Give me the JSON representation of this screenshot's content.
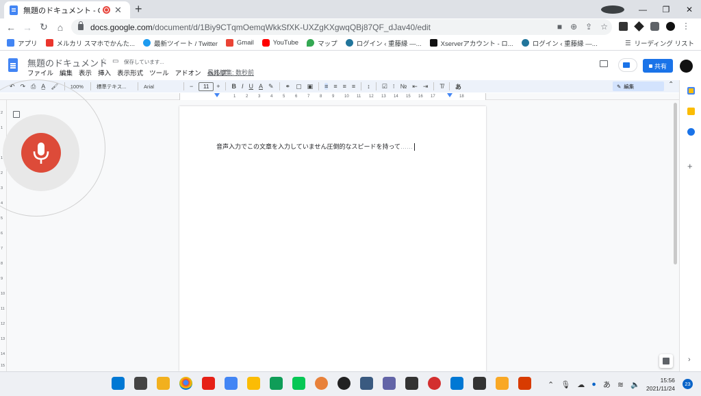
{
  "browser": {
    "tab_title": "無題のドキュメント - Google ド",
    "tab_close": "✕",
    "new_tab": "+",
    "url_host": "docs.google.com",
    "url_path": "/document/d/1Biy9CTqmOemqWkkSfXK-UXZgKXgwqQBj87QF_dJav40/edit",
    "window_controls": [
      "—",
      "❐",
      "✕"
    ]
  },
  "bookmarks": {
    "items": [
      {
        "label": "アプリ",
        "color": "#4285f4"
      },
      {
        "label": "メルカリ スマホでかんた...",
        "color": "#ea352d"
      },
      {
        "label": "最新ツイート / Twitter",
        "color": "#1d9bf0"
      },
      {
        "label": "Gmail",
        "color": "#ea4335"
      },
      {
        "label": "YouTube",
        "color": "#ff0000"
      },
      {
        "label": "マップ",
        "color": "#34a853"
      },
      {
        "label": "ログイン ‹ 重藤縁 —...",
        "color": "#21759b"
      },
      {
        "label": "Xserverアカウント - ロ...",
        "color": "#111111"
      },
      {
        "label": "ログイン ‹ 重藤縁 —...",
        "color": "#21759b"
      }
    ],
    "reading_list": "リーディング リスト"
  },
  "docs": {
    "title": "無題のドキュメント",
    "save_status": "保存しています...",
    "menu": [
      "ファイル",
      "編集",
      "表示",
      "挿入",
      "表示形式",
      "ツール",
      "アドオン",
      "ヘルプ"
    ],
    "last_edit": "最終編集: 数秒前",
    "share_label": "共有",
    "toolbar": {
      "zoom": "100%",
      "style": "標準テキス...",
      "font": "Arial",
      "size": "11",
      "mode": "編集"
    },
    "ruler_ticks": [
      "1",
      "2",
      "3",
      "4",
      "5",
      "6",
      "7",
      "8",
      "9",
      "10",
      "11",
      "12",
      "13",
      "14",
      "15",
      "16",
      "17",
      "18"
    ],
    "vruler_ticks": [
      "2",
      "1",
      "1",
      "2",
      "3",
      "4",
      "5",
      "6",
      "7",
      "8",
      "9",
      "10",
      "11",
      "12",
      "13",
      "14",
      "15"
    ],
    "body_text": "音声入力でこの文章を入力していません圧倒的なスピードを持って",
    "body_ellipsis": "……"
  },
  "taskbar": {
    "icon_colors": [
      "#0078d4",
      "#444444",
      "#f2b01e",
      "#ffffff",
      "#e62117",
      "#4285f4",
      "#fbbc04",
      "#0f9d58",
      "#06c755",
      "#e8813a",
      "#222222",
      "#3a5a80",
      "#6264a7",
      "#333333",
      "#d32f2f",
      "#0078d4",
      "#333333",
      "#f9a825",
      "#d83b01"
    ],
    "ime": "あ",
    "time": "15:56",
    "date": "2021/11/24",
    "notifications": "23"
  }
}
